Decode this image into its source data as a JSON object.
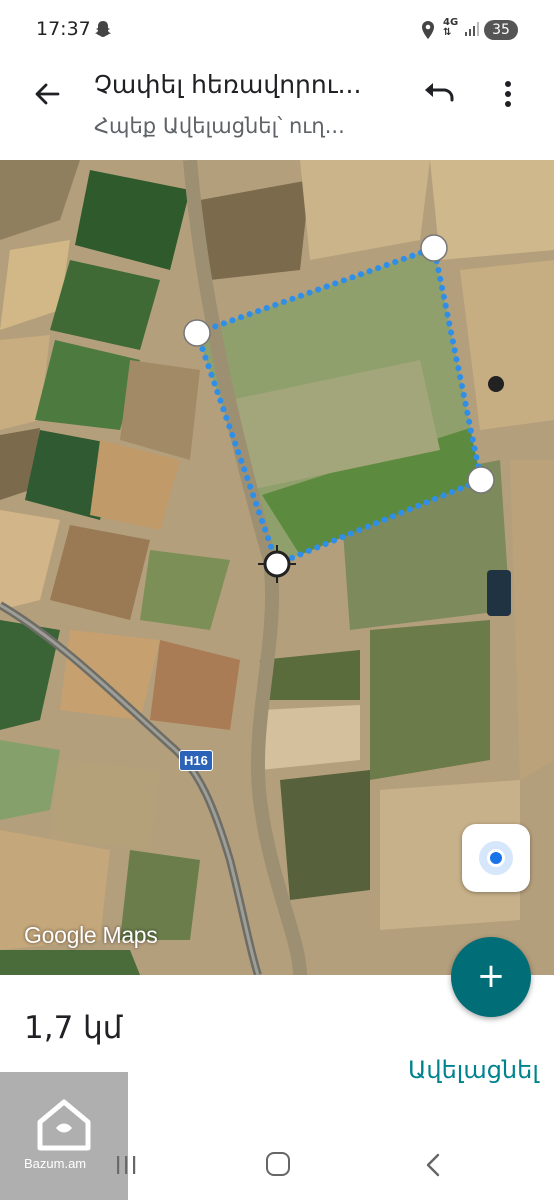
{
  "status_bar": {
    "time": "17:37",
    "network_label": "4G",
    "battery": "35",
    "icons": [
      "snapchat-icon",
      "location-icon",
      "network-icon",
      "signal-icon",
      "battery-icon"
    ]
  },
  "app_bar": {
    "title": "Չափել հեռավորու...",
    "subtitle": "Հպեք Ավելացնել՝ ուղ...",
    "icons": [
      "back-arrow-icon",
      "undo-icon",
      "more-vert-icon"
    ]
  },
  "map": {
    "road_label": "H16",
    "attribution": "Google Maps",
    "measure_color": "#2f8fe8"
  },
  "bottom_panel": {
    "distance": "1,7 կմ",
    "add_label": "Ավելացնել",
    "fab_symbol": "+"
  },
  "watermark": {
    "text": "Bazum.am"
  },
  "colors": {
    "accent": "#006d77",
    "link": "#00838f",
    "location_blue": "#1a73e8"
  }
}
